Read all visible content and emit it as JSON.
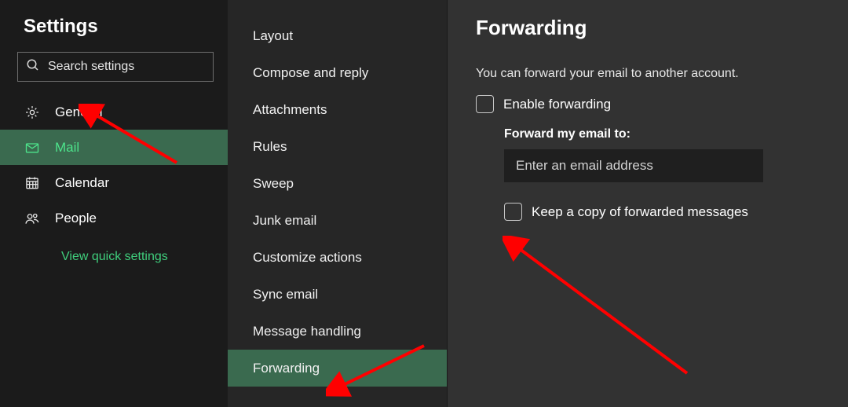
{
  "sidebar": {
    "title": "Settings",
    "search_placeholder": "Search settings",
    "items": [
      {
        "label": "General"
      },
      {
        "label": "Mail"
      },
      {
        "label": "Calendar"
      },
      {
        "label": "People"
      }
    ],
    "quick_link": "View quick settings"
  },
  "subnav": {
    "items": [
      "Layout",
      "Compose and reply",
      "Attachments",
      "Rules",
      "Sweep",
      "Junk email",
      "Customize actions",
      "Sync email",
      "Message handling",
      "Forwarding"
    ]
  },
  "content": {
    "title": "Forwarding",
    "intro": "You can forward your email to another account.",
    "enable_label": "Enable forwarding",
    "forward_to_label": "Forward my email to:",
    "email_placeholder": "Enter an email address",
    "keep_copy_label": "Keep a copy of forwarded messages"
  }
}
